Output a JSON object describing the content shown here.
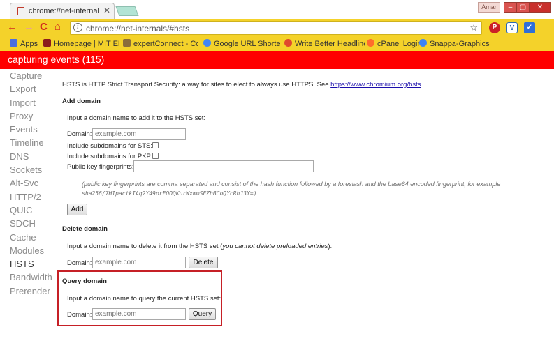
{
  "browser": {
    "tab_title": "chrome://net-internals/#",
    "tab_close": "✕",
    "user_label": "Amar",
    "window_min": "–",
    "window_max": "▢",
    "window_close": "✕",
    "nav_back": "←",
    "nav_forward": "→",
    "nav_reload": "C",
    "nav_home": "⌂",
    "info_icon": "i",
    "url": "chrome://net-internals/#hsts",
    "star": "☆",
    "ext_pin": "P",
    "ext_v": "V",
    "ext_sq": "✓"
  },
  "bookmarks": [
    {
      "label": "Apps",
      "icon": "apps-grid-icon",
      "color": "#4a6ee0"
    },
    {
      "label": "Homepage | MIT EEC",
      "icon": "mit-icon",
      "color": "#8a1c1c"
    },
    {
      "label": "expertConnect - Con",
      "icon": "folder-icon",
      "color": "#8a6d3b"
    },
    {
      "label": "Google URL Shortene",
      "icon": "google-icon",
      "color": "#4285f4"
    },
    {
      "label": "Write Better Headline",
      "icon": "co-icon",
      "color": "#e0492d"
    },
    {
      "label": "cPanel Login",
      "icon": "cpanel-icon",
      "color": "#ff6c2c"
    },
    {
      "label": "Snappa-Graphics",
      "icon": "snappa-icon",
      "color": "#3b82f6"
    }
  ],
  "capture_status": "capturing events (115)",
  "sidebar": [
    "Capture",
    "Export",
    "Import",
    "Proxy",
    "Events",
    "Timeline",
    "DNS",
    "Sockets",
    "Alt-Svc",
    "HTTP/2",
    "QUIC",
    "SDCH",
    "Cache",
    "Modules",
    "HSTS",
    "Bandwidth",
    "Prerender"
  ],
  "active_sidebar": "HSTS",
  "hsts": {
    "intro_text": "HSTS is HTTP Strict Transport Security: a way for sites to elect to always use HTTPS. See ",
    "intro_link": "https://www.chromium.org/hsts",
    "intro_end": ".",
    "add": {
      "title": "Add domain",
      "description": "Input a domain name to add it to the HSTS set:",
      "domain_label": "Domain:",
      "domain_placeholder": "example.com",
      "sts_label": "Include subdomains for STS:",
      "pkp_label": "Include subdomains for PKP:",
      "fingerprints_label": "Public key fingerprints:",
      "note_line1": "(public key fingerprints are comma separated and consist of the hash function followed by a foreslash and the base64 encoded fingerprint, for example",
      "note_line2": "sha256/7HIpactkIAq2Y49orFOOQKurWxmmSFZhBCoQYcRhJ3Y=)",
      "button": "Add"
    },
    "delete": {
      "title": "Delete domain",
      "description_start": "Input a domain name to delete it from the HSTS set (",
      "description_italic": "you cannot delete preloaded entries",
      "description_end": "):",
      "domain_label": "Domain:",
      "domain_placeholder": "example.com",
      "button": "Delete"
    },
    "query": {
      "title": "Query domain",
      "description": "Input a domain name to query the current HSTS set:",
      "domain_label": "Domain:",
      "domain_placeholder": "example.com",
      "button": "Query"
    }
  },
  "colors": {
    "toolbar": "#f4d22a",
    "capture_bar": "#ff0000",
    "highlight_box": "#c62026"
  }
}
